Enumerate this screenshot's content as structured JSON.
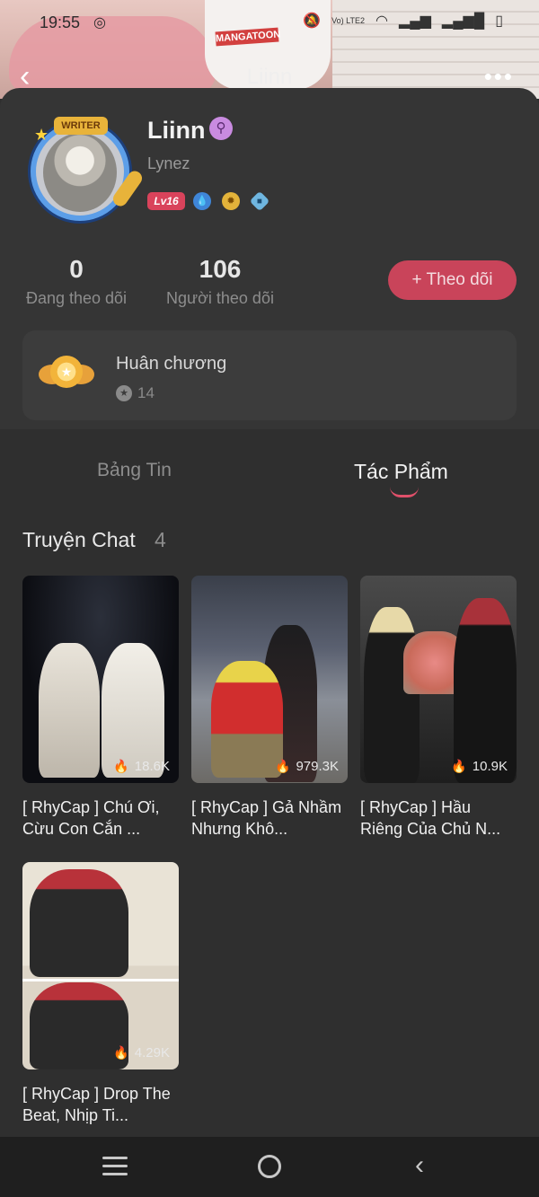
{
  "status_bar": {
    "time": "19:55",
    "network": "Vo) LTE2"
  },
  "header": {
    "title": "Liinn",
    "back_icon": "chevron-left-icon",
    "more_icon": "more-dots-icon"
  },
  "profile": {
    "avatar_badge": "WRITER",
    "name": "Liinn",
    "handle": "Lynez",
    "level": "Lv16",
    "stats": {
      "following_count": "0",
      "following_label": "Đang theo dõi",
      "followers_count": "106",
      "followers_label": "Người theo dõi"
    },
    "follow_button": "+ Theo dõi"
  },
  "medals": {
    "title": "Huân chương",
    "count": "14"
  },
  "tabs": [
    {
      "label": "Bảng Tin",
      "active": false
    },
    {
      "label": "Tác Phẩm",
      "active": true
    }
  ],
  "section": {
    "title": "Truyện Chat",
    "count": "4"
  },
  "works": [
    {
      "title": "[ RhyCap ] Chú Ơi, Cừu Con Cắn ...",
      "views": "18.6K"
    },
    {
      "title": "[ RhyCap ] Gả Nhầm Nhưng Khô...",
      "views": "979.3K"
    },
    {
      "title": "[ RhyCap ] Hầu Riêng Của Chủ N...",
      "views": "10.9K"
    },
    {
      "title": "[ RhyCap ] Drop The Beat, Nhịp Ti...",
      "views": "4.29K"
    }
  ],
  "colors": {
    "accent": "#c9445a",
    "background": "#2f2f2f",
    "card": "#353535"
  }
}
